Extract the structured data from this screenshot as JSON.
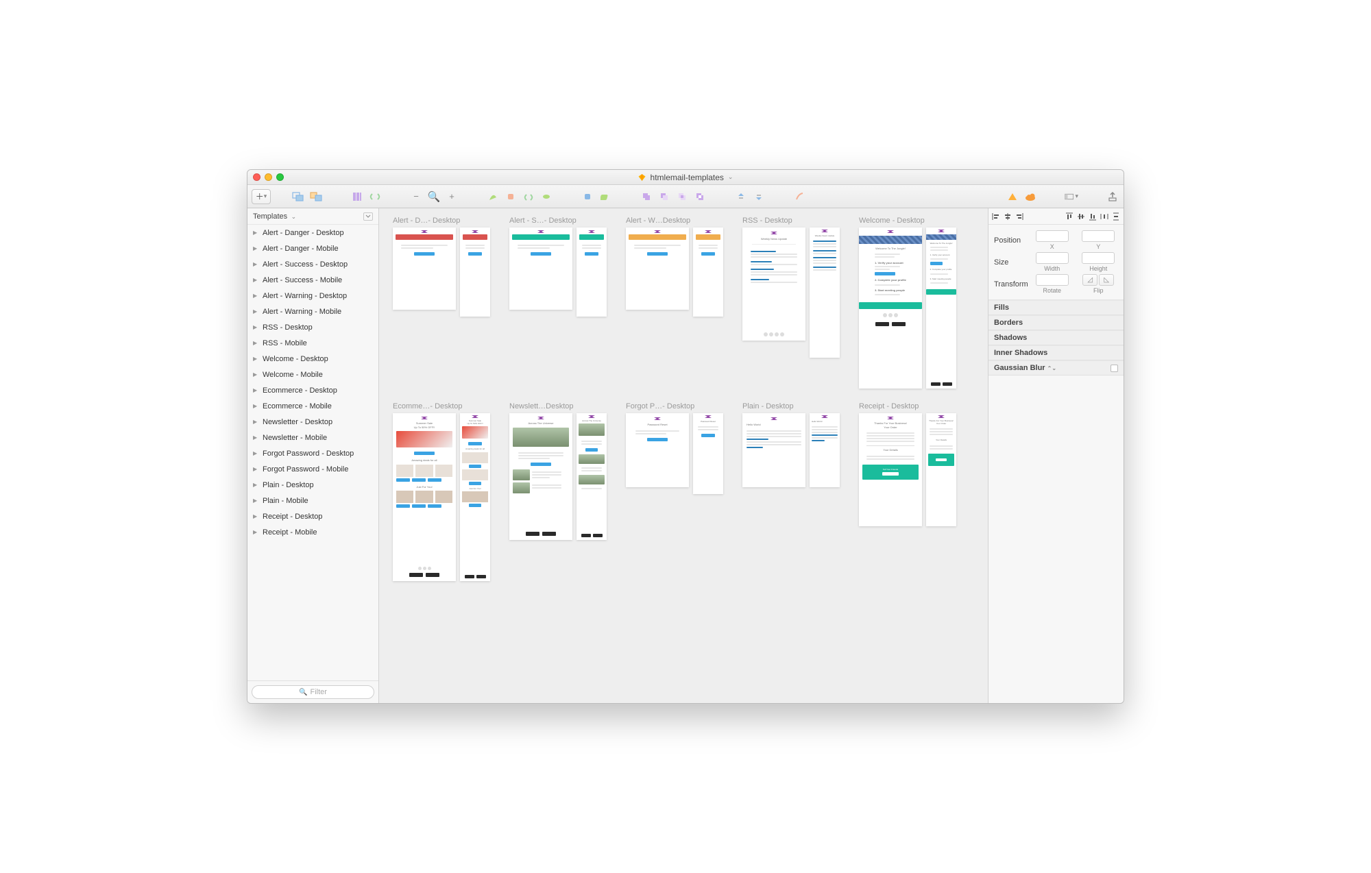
{
  "window": {
    "title": "htmlemail-templates"
  },
  "sidebar": {
    "header": "Templates",
    "filter_placeholder": "Filter",
    "items": [
      "Alert - Danger - Desktop",
      "Alert - Danger - Mobile",
      "Alert - Success - Desktop",
      "Alert - Success - Mobile",
      "Alert - Warning - Desktop",
      "Alert - Warning - Mobile",
      "RSS - Desktop",
      "RSS - Mobile",
      "Welcome - Desktop",
      "Welcome - Mobile",
      "Ecommerce - Desktop",
      "Ecommerce - Mobile",
      "Newsletter - Desktop",
      "Newsletter - Mobile",
      "Forgot Password - Desktop",
      "Forgot Password - Mobile",
      "Plain - Desktop",
      "Plain - Mobile",
      "Receipt - Desktop",
      "Receipt - Mobile"
    ]
  },
  "canvas": {
    "row1": [
      "Alert - D…- Desktop",
      "Alert - S…- Desktop",
      "Alert - W…Desktop",
      "RSS - Desktop",
      "Welcome - Desktop"
    ],
    "row2": [
      "Ecomme…- Desktop",
      "Newslett…Desktop",
      "Forgot P…- Desktop",
      "Plain - Desktop",
      "Receipt - Desktop"
    ]
  },
  "inspector": {
    "position": {
      "label": "Position",
      "x": "X",
      "y": "Y"
    },
    "size": {
      "label": "Size",
      "w": "Width",
      "h": "Height"
    },
    "transform": {
      "label": "Transform",
      "rotate": "Rotate",
      "flip": "Flip"
    },
    "sections": {
      "fills": "Fills",
      "borders": "Borders",
      "shadows": "Shadows",
      "inner_shadows": "Inner Shadows",
      "gaussian_blur": "Gaussian Blur"
    }
  },
  "artboard_text": {
    "rss_title": "Weekly News Update",
    "welcome_title": "Welcome To The Jungle!",
    "welcome_step1": "1. Verify your account",
    "welcome_step2": "2. Complete your profile",
    "welcome_step3": "3. Start meeting people",
    "ecom_title": "Summer Sale",
    "ecom_sub": "Up To 50% OFF!!",
    "ecom_deals": "Amazing deals for all",
    "ecom_just": "Just For You!",
    "news_title": "Across The Universe",
    "forgot_title": "Password Reset",
    "plain_title": "Hello World",
    "receipt_title": "Thanks For Your Business!",
    "receipt_order": "Your Order",
    "receipt_details": "Your Details",
    "receipt_friends": "Tell Your Friends"
  }
}
